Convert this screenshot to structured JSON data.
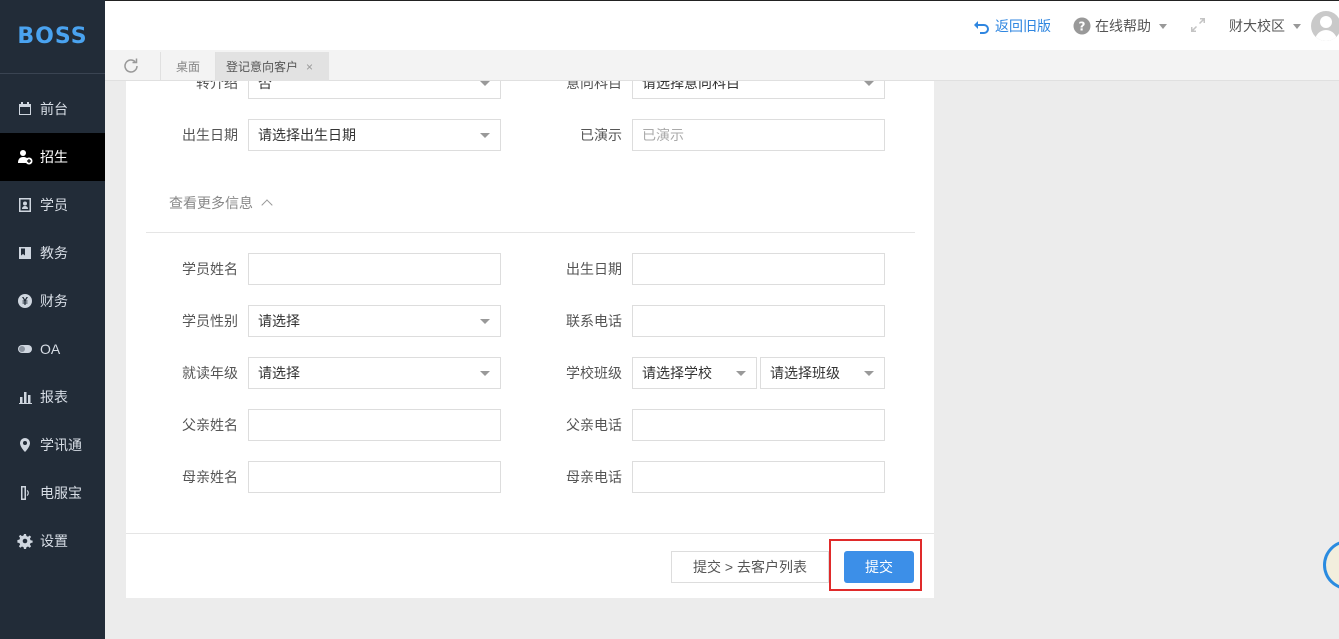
{
  "brand": {
    "logo_text": "BOSS"
  },
  "sidebar": {
    "items": [
      {
        "label": "前台",
        "icon": "calendar-icon",
        "active": false
      },
      {
        "label": "招生",
        "icon": "add-user-icon",
        "active": true
      },
      {
        "label": "学员",
        "icon": "id-card-icon",
        "active": false
      },
      {
        "label": "教务",
        "icon": "book-icon",
        "active": false
      },
      {
        "label": "财务",
        "icon": "yen-icon",
        "active": false
      },
      {
        "label": "OA",
        "icon": "toggle-icon",
        "active": false
      },
      {
        "label": "报表",
        "icon": "bar-chart-icon",
        "active": false
      },
      {
        "label": "学讯通",
        "icon": "location-pin-icon",
        "active": false
      },
      {
        "label": "电服宝",
        "icon": "phone-icon",
        "active": false
      },
      {
        "label": "设置",
        "icon": "gear-icon",
        "active": false
      }
    ]
  },
  "header": {
    "back_old": "返回旧版",
    "help": "在线帮助",
    "campus": "财大校区"
  },
  "tabs": {
    "desk": "桌面",
    "active": "登记意向客户",
    "close": "×"
  },
  "form": {
    "partial_top": {
      "left_label": "转介绍",
      "left_value": "否",
      "right_label": "意向科目",
      "right_value": "请选择意向科目"
    },
    "birth_label": "出生日期",
    "birth_placeholder": "请选择出生日期",
    "demo_label": "已演示",
    "demo_placeholder": "已演示",
    "more_info": "查看更多信息",
    "student_name_label": "学员姓名",
    "student_birth_label": "出生日期",
    "gender_label": "学员性别",
    "gender_value": "请选择",
    "phone_label": "联系电话",
    "grade_label": "就读年级",
    "grade_value": "请选择",
    "school_class_label": "学校班级",
    "school_value": "请选择学校",
    "class_value": "请选择班级",
    "father_name_label": "父亲姓名",
    "father_phone_label": "父亲电话",
    "mother_name_label": "母亲姓名",
    "mother_phone_label": "母亲电话"
  },
  "footer": {
    "submit_to_list": "提交 > 去客户列表",
    "submit": "提交"
  },
  "colors": {
    "sidebar_bg": "#222c38",
    "accent": "#3c8fe8",
    "highlight": "#e02a2a"
  }
}
